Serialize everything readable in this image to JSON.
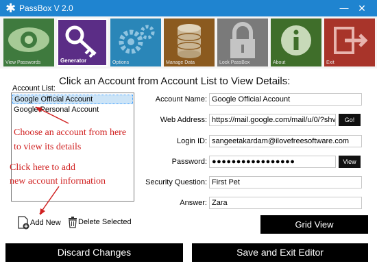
{
  "window": {
    "title": "PassBox V 2.0",
    "app_icon": "asterisk-icon",
    "minimize": "—",
    "close": "✕"
  },
  "toolbar": {
    "items": [
      {
        "label": "View Passwords",
        "icon": "eye-icon",
        "color": "#3f7a3e",
        "active": false
      },
      {
        "label": "Generator",
        "icon": "key-icon",
        "color": "#5b2d86",
        "active": true
      },
      {
        "label": "Options",
        "icon": "gears-icon",
        "color": "#2a86b8",
        "active": false
      },
      {
        "label": "Manage Data",
        "icon": "database-icon",
        "color": "#8b5a1f",
        "active": false
      },
      {
        "label": "Lock PassBox",
        "icon": "lock-icon",
        "color": "#7a7a7a",
        "active": false
      },
      {
        "label": "About",
        "icon": "info-icon",
        "color": "#3f6e2a",
        "active": false
      },
      {
        "label": "Exit",
        "icon": "exit-icon",
        "color": "#a8342a",
        "active": false
      }
    ]
  },
  "main": {
    "heading": "Click an Account from Account List to View Details:",
    "account_list_label": "Account List:",
    "accounts": [
      "Google Official Account",
      "Google Personal Account"
    ],
    "selected_account_index": 0
  },
  "annotations": {
    "choose_line1": "Choose an account from here",
    "choose_line2": "to view its details",
    "add_line1": "Click here to add",
    "add_line2": "new account information"
  },
  "details": {
    "account_name_label": "Account Name:",
    "account_name_value": "Google Official Account",
    "web_address_label": "Web Address:",
    "web_address_value": "https://mail.google.com/mail/u/0/?shv",
    "go_label": "Go!",
    "login_id_label": "Login ID:",
    "login_id_value": "sangeetakardam@ilovefreesoftware.com",
    "password_label": "Password:",
    "password_value": "●●●●●●●●●●●●●●●●●",
    "view_label": "View",
    "security_question_label": "Security Question:",
    "security_question_value": "First Pet",
    "answer_label": "Answer:",
    "answer_value": "Zara"
  },
  "actions": {
    "add_new": "Add New",
    "delete_selected": "Delete Selected",
    "grid_view": "Grid View",
    "discard_changes": "Discard Changes",
    "save_exit": "Save and Exit Editor"
  },
  "colors": {
    "titlebar": "#1f84d0",
    "annotation_red": "#d02020",
    "button_black": "#000000"
  }
}
